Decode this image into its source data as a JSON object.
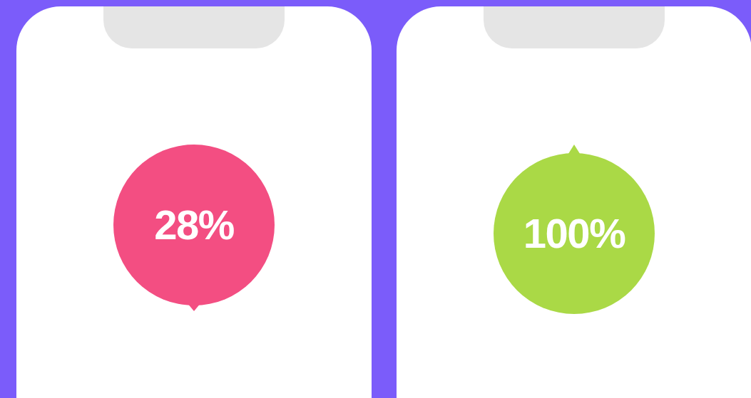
{
  "phones": [
    {
      "value": "28%",
      "color": "#f34e82",
      "pointer_up": false
    },
    {
      "value": "100%",
      "color": "#aad946",
      "pointer_up": true
    }
  ]
}
